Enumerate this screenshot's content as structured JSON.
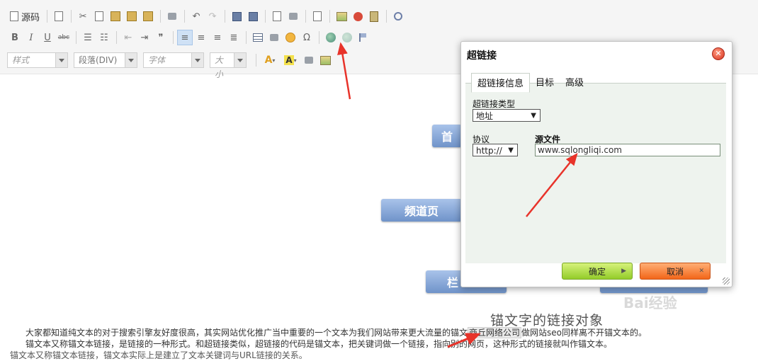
{
  "toolbar": {
    "source_label": "源码",
    "style_combo": "样式",
    "paragraph_combo": "段落(DIV)",
    "font_combo": "字体",
    "size_combo": "大小",
    "bold": "B",
    "italic": "I",
    "underline": "U",
    "strike": "abc",
    "omega": "Ω",
    "quote": "❞"
  },
  "editor": {
    "nodes": [
      "首",
      "频道页",
      "栏",
      ""
    ],
    "anchor_title": "锚文字的链接对象",
    "watermark": "Bai经验",
    "para_line1_a": "大家都知道纯文本的对于搜索引擎友好度很高，其实网站优化推广当中重要的一个文本为我们网站带来更大流量的锚文",
    "para_line1_link": "商丘网络公司",
    "para_line1_b": "做网站seo同样离不开锚文本的。",
    "para_line2": "锚文本又称锚文本链接，是链接的一种形式。和超链接类似，超链接的代码是锚文本，把关键词做一个链接，指向别的网页，这种形式的链接就叫作锚文本。",
    "para_line3": "锚文本又称锚文本链接，锚文本实际上是建立了文本关键词与URL链接的关系。"
  },
  "dialog": {
    "title": "超链接",
    "tabs": [
      "超链接信息",
      "目标",
      "高级"
    ],
    "link_type_label": "超链接类型",
    "link_type_value": "地址",
    "protocol_label": "协议",
    "protocol_value": "http://",
    "source_label": "源文件",
    "url_value": "www.sqlongliqi.com",
    "ok_label": "确定",
    "cancel_label": "取消"
  },
  "colors": {
    "arrow": "#e8332a",
    "ok_button": "#a6d63a",
    "cancel_button": "#f47a2e",
    "node": "#8aa9d9"
  }
}
